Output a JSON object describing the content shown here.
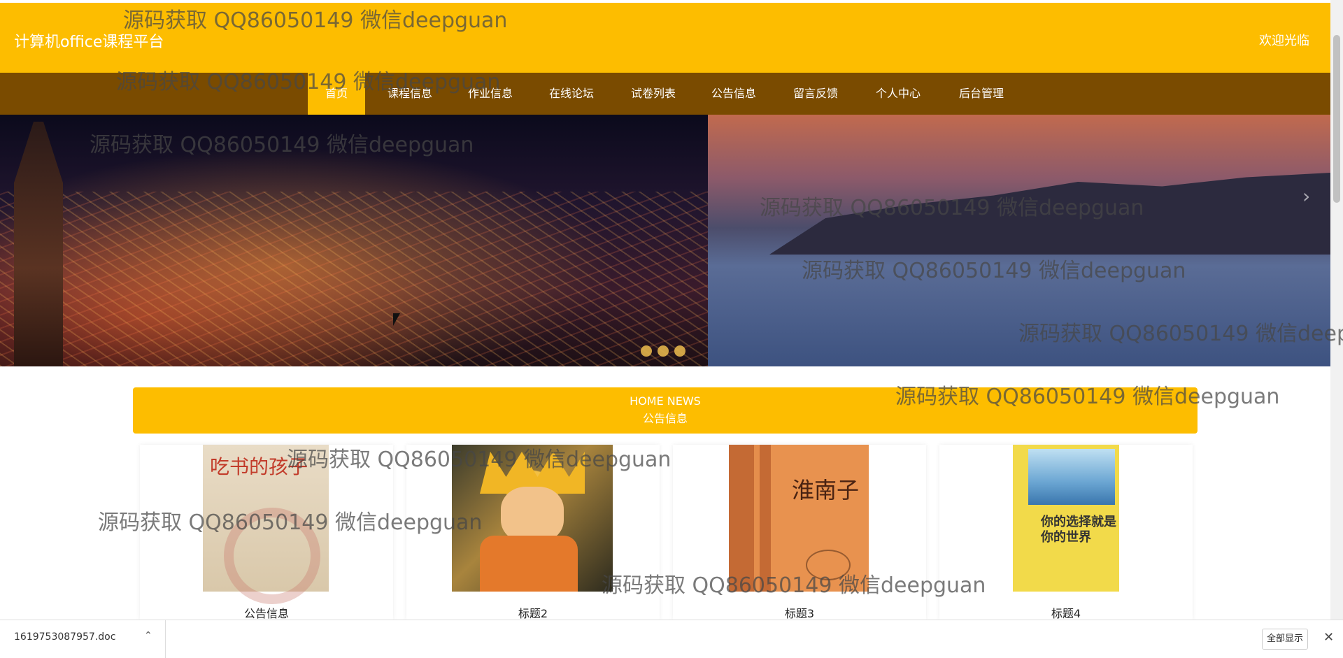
{
  "header": {
    "site_title": "计算机office课程平台",
    "welcome_text": "欢迎光临"
  },
  "nav": {
    "items": [
      {
        "label": "首页",
        "active": true
      },
      {
        "label": "课程信息"
      },
      {
        "label": "作业信息"
      },
      {
        "label": "在线论坛"
      },
      {
        "label": "试卷列表"
      },
      {
        "label": "公告信息"
      },
      {
        "label": "留言反馈"
      },
      {
        "label": "个人中心"
      },
      {
        "label": "后台管理"
      }
    ]
  },
  "carousel": {
    "slide_count": 3,
    "next_arrow": "›"
  },
  "news_section": {
    "title_en": "HOME NEWS",
    "title_cn": "公告信息"
  },
  "cards": [
    {
      "title": "公告信息",
      "cover_text": "吃书的孩子"
    },
    {
      "title": "标题2"
    },
    {
      "title": "标题3",
      "cover_text": "淮南子"
    },
    {
      "title": "标题4",
      "cover_text": "你的选择就是你的世界"
    }
  ],
  "download_bar": {
    "file_name": "1619753087957.doc",
    "chevron": "⌃",
    "show_all_label": "全部显示",
    "close_icon": "✕"
  },
  "watermark_text": "源码获取 QQ86050149 微信deepguan",
  "colors": {
    "header_bg": "#fdbd00",
    "nav_bg": "#7a4b00",
    "accent": "#fdbd00"
  }
}
